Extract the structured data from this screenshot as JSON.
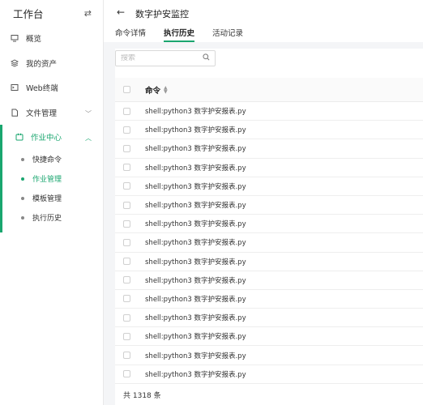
{
  "sidebar": {
    "title": "工作台",
    "toggle_icon": "swap-icon",
    "items": [
      {
        "label": "概览",
        "icon": "monitor-icon"
      },
      {
        "label": "我的资产",
        "icon": "stack-icon"
      },
      {
        "label": "Web终端",
        "icon": "terminal-icon"
      },
      {
        "label": "文件管理",
        "icon": "file-icon"
      },
      {
        "label": "作业中心",
        "icon": "job-icon"
      }
    ],
    "submenu": [
      {
        "label": "快捷命令"
      },
      {
        "label": "作业管理"
      },
      {
        "label": "模板管理"
      },
      {
        "label": "执行历史"
      }
    ]
  },
  "header": {
    "title": "数字护安监控",
    "tabs": [
      {
        "label": "命令详情"
      },
      {
        "label": "执行历史"
      },
      {
        "label": "活动记录"
      }
    ]
  },
  "search": {
    "placeholder": "搜索"
  },
  "table": {
    "column": "命令",
    "rows": [
      "shell:python3 数字护安报表.py",
      "shell:python3 数字护安报表.py",
      "shell:python3 数字护安报表.py",
      "shell:python3 数字护安报表.py",
      "shell:python3 数字护安报表.py",
      "shell:python3 数字护安报表.py",
      "shell:python3 数字护安报表.py",
      "shell:python3 数字护安报表.py",
      "shell:python3 数字护安报表.py",
      "shell:python3 数字护安报表.py",
      "shell:python3 数字护安报表.py",
      "shell:python3 数字护安报表.py",
      "shell:python3 数字护安报表.py",
      "shell:python3 数字护安报表.py",
      "shell:python3 数字护安报表.py"
    ]
  },
  "footer": {
    "total": "共 1318 条"
  },
  "colors": {
    "accent": "#1aa66f"
  }
}
